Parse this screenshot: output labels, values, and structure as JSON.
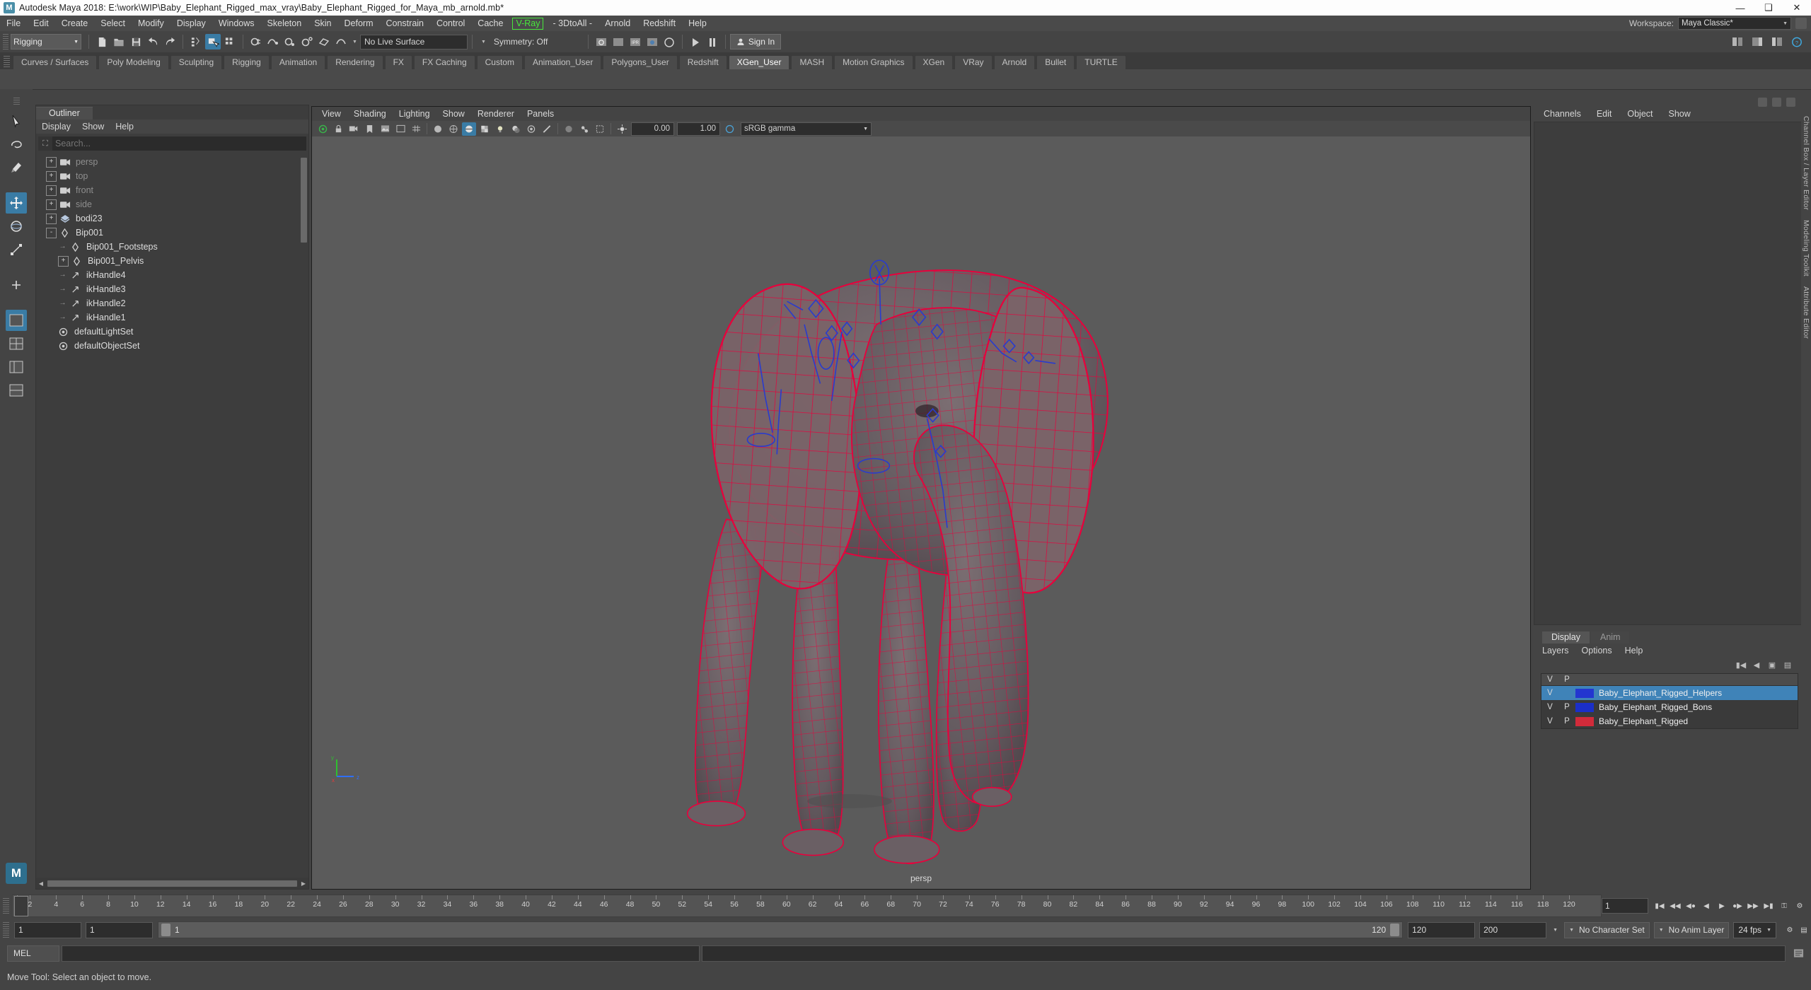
{
  "window": {
    "title": "Autodesk Maya 2018: E:\\work\\WIP\\Baby_Elephant_Rigged_max_vray\\Baby_Elephant_Rigged_for_Maya_mb_arnold.mb*",
    "logo": "M",
    "minimize": "—",
    "maximize": "❑",
    "close": "✕"
  },
  "menubar": {
    "items": [
      "File",
      "Edit",
      "Create",
      "Select",
      "Modify",
      "Display",
      "Windows",
      "Skeleton",
      "Skin",
      "Deform",
      "Constrain",
      "Control",
      "Cache"
    ],
    "vray": "V-Ray",
    "dtsall": "- 3DtoAll -",
    "after": [
      "Arnold",
      "Redshift",
      "Help"
    ],
    "workspace_label": "Workspace:",
    "workspace_value": "Maya Classic*"
  },
  "statusline": {
    "mode": "Rigging",
    "live_surface": "No Live Surface",
    "symmetry": "Symmetry: Off",
    "signin": "Sign In",
    "icons": [
      "new-scene-icon",
      "open-scene-icon",
      "save-scene-icon",
      "undo-icon",
      "redo-icon",
      "select-by-hierarchy-icon",
      "select-by-object-icon",
      "select-by-component-icon",
      "snap-to-grid-icon",
      "snap-to-curve-icon",
      "snap-to-point-icon",
      "snap-to-projected-center-icon",
      "snap-to-view-planes-icon",
      "make-live-icon",
      "render-current-frame-icon",
      "ipr-render-icon",
      "render-settings-icon",
      "hypershade-icon",
      "render-view-icon",
      "playblast-icon"
    ]
  },
  "shelf": {
    "tabs": [
      "Curves / Surfaces",
      "Poly Modeling",
      "Sculpting",
      "Rigging",
      "Animation",
      "Rendering",
      "FX",
      "FX Caching",
      "Custom",
      "Animation_User",
      "Polygons_User",
      "Redshift",
      "XGen_User",
      "MASH",
      "Motion Graphics",
      "XGen",
      "VRay",
      "Arnold",
      "Bullet",
      "TURTLE"
    ],
    "active": "XGen_User"
  },
  "toolbox": {
    "items": [
      "select-tool",
      "lasso-select-tool",
      "paint-select-tool",
      "move-tool",
      "rotate-tool",
      "scale-tool",
      "last-tool-used",
      "show-manipulator-tool",
      "layout-single-perspective",
      "layout-four-view",
      "layout-persp-outliner",
      "layout-persp-graph"
    ]
  },
  "outliner": {
    "tab": "Outliner",
    "menus": [
      "Display",
      "Show",
      "Help"
    ],
    "search_placeholder": "Search...",
    "items": [
      {
        "label": "persp",
        "icon": "camera-icon",
        "indent": 0,
        "expand": "+",
        "dim": true
      },
      {
        "label": "top",
        "icon": "camera-icon",
        "indent": 0,
        "expand": "+",
        "dim": true
      },
      {
        "label": "front",
        "icon": "camera-icon",
        "indent": 0,
        "expand": "+",
        "dim": true
      },
      {
        "label": "side",
        "icon": "camera-icon",
        "indent": 0,
        "expand": "+",
        "dim": true
      },
      {
        "label": "bodi23",
        "icon": "mesh-icon",
        "indent": 0,
        "expand": "+",
        "dim": false
      },
      {
        "label": "Bip001",
        "icon": "joint-icon",
        "indent": 0,
        "expand": "-",
        "dim": false
      },
      {
        "label": "Bip001_Footsteps",
        "icon": "joint-icon",
        "indent": 1,
        "expand": "→",
        "dim": false
      },
      {
        "label": "Bip001_Pelvis",
        "icon": "joint-icon",
        "indent": 1,
        "expand": "+",
        "dim": false
      },
      {
        "label": "ikHandle4",
        "icon": "ikhandle-icon",
        "indent": 1,
        "expand": "→",
        "dim": false
      },
      {
        "label": "ikHandle3",
        "icon": "ikhandle-icon",
        "indent": 1,
        "expand": "→",
        "dim": false
      },
      {
        "label": "ikHandle2",
        "icon": "ikhandle-icon",
        "indent": 1,
        "expand": "→",
        "dim": false
      },
      {
        "label": "ikHandle1",
        "icon": "ikhandle-icon",
        "indent": 1,
        "expand": "→",
        "dim": false
      },
      {
        "label": "defaultLightSet",
        "icon": "set-icon",
        "indent": 0,
        "expand": "",
        "dim": false
      },
      {
        "label": "defaultObjectSet",
        "icon": "set-icon",
        "indent": 0,
        "expand": "",
        "dim": false
      }
    ]
  },
  "viewport": {
    "menus": [
      "View",
      "Shading",
      "Lighting",
      "Show",
      "Renderer",
      "Panels"
    ],
    "exposure": "0.00",
    "gamma": "1.00",
    "color_profile": "sRGB gamma",
    "camera_label": "persp",
    "axis": {
      "x": "x",
      "y": "y",
      "z": "z"
    },
    "model_colors": {
      "wireframe": "#e8003c",
      "surface": "#6d6166",
      "bones": "#2233aa"
    }
  },
  "channels": {
    "menus": [
      "Channels",
      "Edit",
      "Object",
      "Show"
    ]
  },
  "layers": {
    "tabs": [
      "Display",
      "Anim"
    ],
    "active_tab": "Display",
    "menus": [
      "Layers",
      "Options",
      "Help"
    ],
    "col_v": "V",
    "col_p": "P",
    "rows": [
      {
        "v": "V",
        "p": "",
        "color": "#2336d0",
        "name": "Baby_Elephant_Rigged_Helpers",
        "selected": true
      },
      {
        "v": "V",
        "p": "P",
        "color": "#1b2fc8",
        "name": "Baby_Elephant_Rigged_Bons",
        "selected": false
      },
      {
        "v": "V",
        "p": "P",
        "color": "#d22b3a",
        "name": "Baby_Elephant_Rigged",
        "selected": false
      }
    ]
  },
  "right_strip": {
    "labels": [
      "Channel Box / Layer Editor",
      "Modeling Toolkit",
      "Attribute Editor"
    ]
  },
  "timeline": {
    "current_frame": "1",
    "ticks": [
      1,
      2,
      4,
      6,
      8,
      10,
      12,
      14,
      16,
      18,
      20,
      22,
      24,
      26,
      28,
      30,
      32,
      34,
      36,
      38,
      40,
      42,
      44,
      46,
      48,
      50,
      52,
      54,
      56,
      58,
      60,
      62,
      64,
      66,
      68,
      70,
      72,
      74,
      76,
      78,
      80,
      82,
      84,
      86,
      88,
      90,
      92,
      94,
      96,
      98,
      100,
      102,
      104,
      106,
      108,
      110,
      112,
      114,
      116,
      118,
      120
    ],
    "field_value": "1"
  },
  "range": {
    "start": "1",
    "anim_start": "1",
    "playback_start": "1",
    "playback_end": "120",
    "anim_end": "120",
    "end": "200",
    "character_set": "No Character Set",
    "anim_layer": "No Anim Layer",
    "fps": "24 fps"
  },
  "command": {
    "label": "MEL",
    "input_value": "",
    "output_value": ""
  },
  "helpline": {
    "text": "Move Tool: Select an object to move."
  }
}
